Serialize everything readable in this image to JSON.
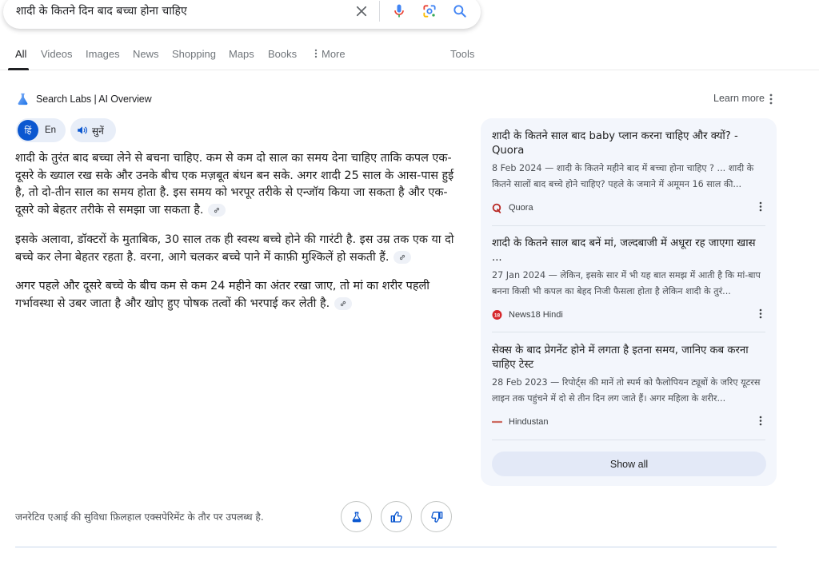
{
  "search": {
    "query": "शादी के कितने दिन बाद बच्चा होना चाहिए",
    "clear_icon": "close-icon",
    "voice_icon": "microphone-icon",
    "lens_icon": "google-lens-icon",
    "search_icon": "search-icon"
  },
  "tabs": [
    {
      "label": "All",
      "active": true
    },
    {
      "label": "Videos"
    },
    {
      "label": "Images"
    },
    {
      "label": "News"
    },
    {
      "label": "Shopping"
    },
    {
      "label": "Maps"
    },
    {
      "label": "Books"
    },
    {
      "label": "More",
      "icon": "vertical-dots-icon"
    }
  ],
  "tools_label": "Tools",
  "ai_overview": {
    "header_label": "Search Labs | AI Overview",
    "header_icon": "flask-icon",
    "learn_more": "Learn more",
    "language": {
      "hindi_label": "हिं",
      "english_label": "En",
      "selected": "hi"
    },
    "listen_label": "सुनें",
    "paragraphs": [
      "शादी के तुरंत बाद बच्चा लेने से बचना चाहिए. कम से कम दो साल का समय देना चाहिए ताकि कपल एक-दूसरे के ख्याल रख सके और उनके बीच एक मज़बूत बंधन बन सके. अगर शादी 25 साल के आस-पास हुई है, तो दो-तीन साल का समय होता है. इस समय को भरपूर तरीके से एन्जॉय किया जा सकता है और एक-दूसरे को बेहतर तरीके से समझा जा सकता है.",
      "इसके अलावा, डॉक्टरों के मुताबिक, 30 साल तक ही स्वस्थ बच्चे होने की गारंटी है. इस उम्र तक एक या दो बच्चे कर लेना बेहतर रहता है. वरना, आगे चलकर बच्चे पाने में काफ़ी मुश्किलें हो सकती हैं.",
      "अगर पहले और दूसरे बच्चे के बीच कम से कम 24 महीने का अंतर रखा जाए, तो मां का शरीर पहली गर्भावस्था से उबर जाता है और खोए हुए पोषक तत्वों की भरपाई कर लेती है."
    ],
    "sources": [
      {
        "title": "शादी के कितने साल बाद baby प्लान करना चाहिए और क्यों? - Quora",
        "snippet": "8 Feb 2024 — शादी के कितने महीने बाद में बच्चा होना चाहिए ? ... शादी के कितने सालों बाद बच्चे होने चाहिए? पहले के जमाने में अमूमन 16 साल की...",
        "site": "Quora",
        "favicon_color": "#b92b27"
      },
      {
        "title": "शादी के कितने साल बाद बनें मां, जल्दबाजी में अधूरा रह जाएगा खास ...",
        "snippet": "27 Jan 2024 — लेकिन, इसके सार में भी यह बात समझ में आती है कि मां-बाप बनना किसी भी कपल का बेहद निजी फैसला होता है लेकिन शादी के तुरं...",
        "site": "News18 Hindi",
        "favicon_text": "18",
        "favicon_color": "#d6262b"
      },
      {
        "title": "सेक्स के बाद प्रेगनेंट होने में लगता है इतना समय, जानिए कब करना चाहिए टेस्ट",
        "snippet": "28 Feb 2023 — रिपोर्ट्स की मानें तो स्पर्म को फैलोपियन ट्यूबों के जरिए यूटरस लाइन तक पहुंचने में दो से तीन दिन लग जाते हैं। अगर महिला के शरीर...",
        "site": "Hindustan",
        "favicon_color": "#c0392b"
      }
    ],
    "show_all_label": "Show all",
    "footer_note": "जनरेटिव एआई की सुविधा फ़िलहाल एक्सपेरिमेंट के तौर पर उपलब्ध है.",
    "feedback_buttons": [
      "labs-flask-icon",
      "thumbs-up-icon",
      "thumbs-down-icon"
    ],
    "accent_color": "#0b57d0"
  }
}
